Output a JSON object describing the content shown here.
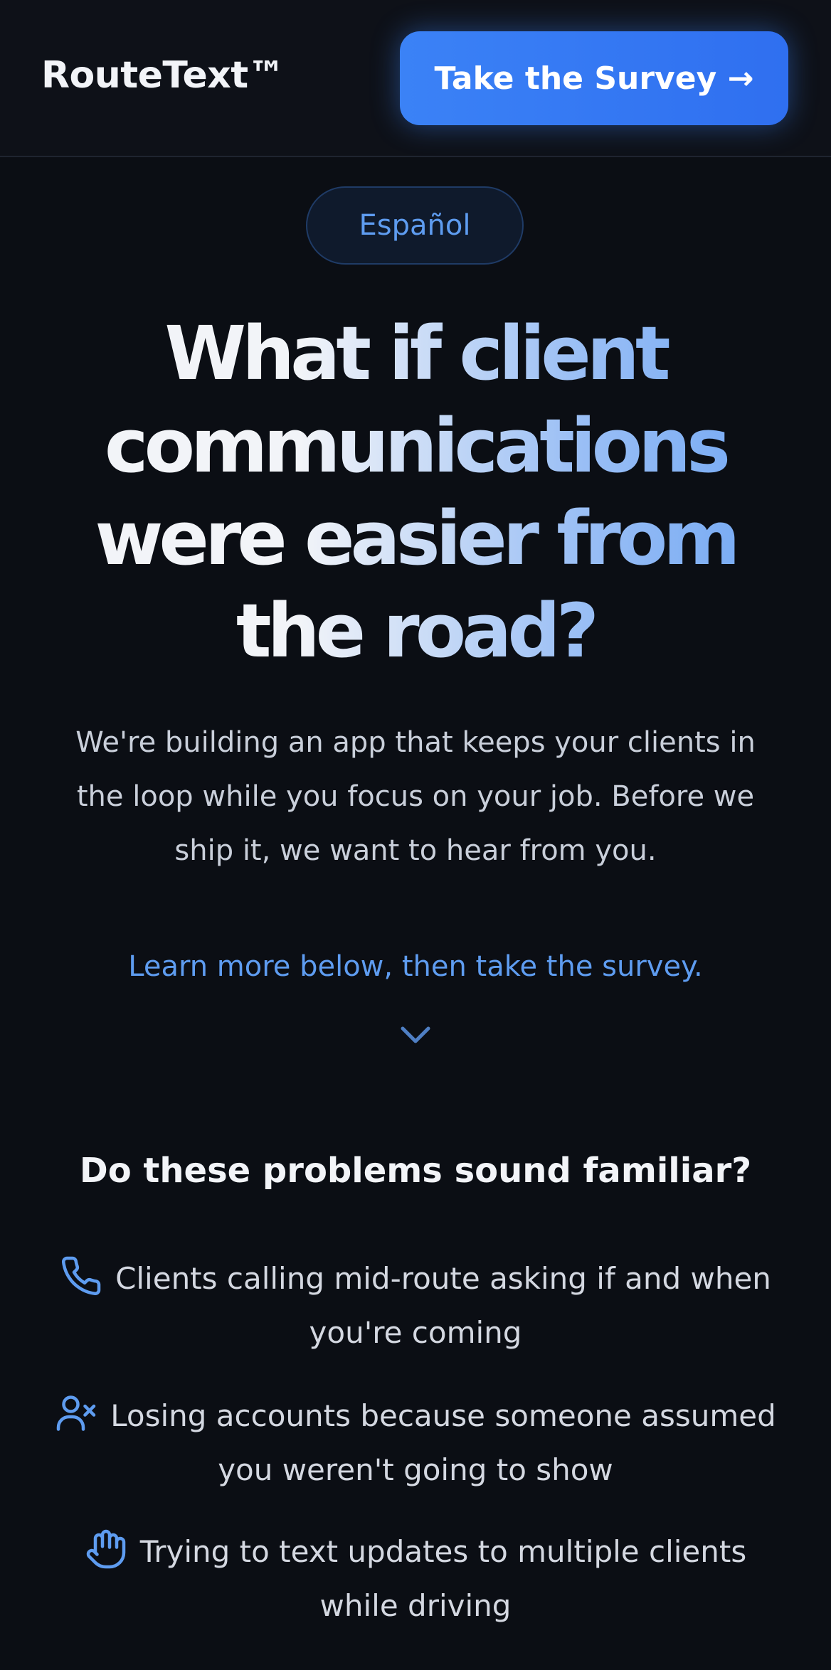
{
  "header": {
    "brand": "RouteText™",
    "cta_label": "Take the Survey →"
  },
  "language_toggle": "Español",
  "hero": {
    "headline": "What if client communications were easier from the road?",
    "lede": "We're building an app that keeps your clients in the loop while you focus on your job. Before we ship it, we want to hear from you.",
    "learn_more": "Learn more below, then take the survey."
  },
  "problems": {
    "title": "Do these problems sound familiar?",
    "items": [
      {
        "icon": "phone-icon",
        "text": "Clients calling mid-route asking if and when you're coming"
      },
      {
        "icon": "user-x-icon",
        "text": "Losing accounts because someone assumed you weren't going to show"
      },
      {
        "icon": "hand-icon",
        "text": "Trying to text updates to multiple clients while driving"
      }
    ]
  },
  "colors": {
    "background": "#0b0e14",
    "accent": "#3b82f6",
    "link": "#5e9cf0"
  }
}
